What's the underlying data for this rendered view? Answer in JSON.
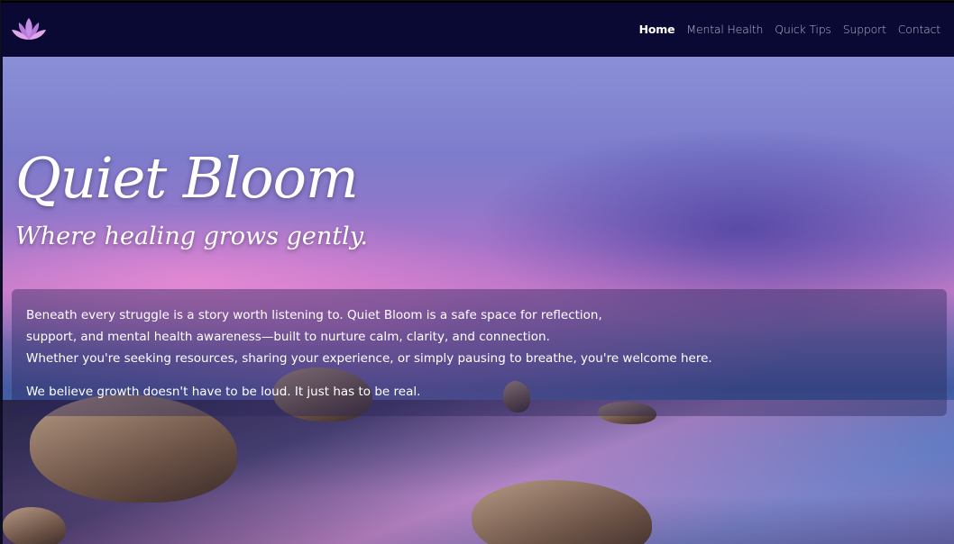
{
  "brand": {
    "logo_icon": "lotus-icon",
    "logo_colors": [
      "#b57bdc",
      "#e3a6e8"
    ]
  },
  "nav": {
    "items": [
      {
        "label": "Home",
        "active": true
      },
      {
        "label": "Mental Health",
        "active": false
      },
      {
        "label": "Quick Tips",
        "active": false
      },
      {
        "label": "Support",
        "active": false
      },
      {
        "label": "Contact",
        "active": false
      }
    ]
  },
  "hero": {
    "title": "Quiet Bloom",
    "subtitle": "Where healing grows gently.",
    "intro_lines": [
      "Beneath every struggle is a story worth listening to. Quiet Bloom is a safe space for reflection,",
      "support, and mental health awareness—built to nurture calm, clarity, and connection.",
      "Whether you're seeking resources, sharing your experience, or simply pausing to breathe, you're welcome here."
    ],
    "closing": "We believe growth doesn't have to be loud. It just has to be real."
  },
  "colors": {
    "navbar_bg": "#0a0933",
    "nav_text": "#b9b8d2",
    "nav_active": "#ffffff"
  }
}
